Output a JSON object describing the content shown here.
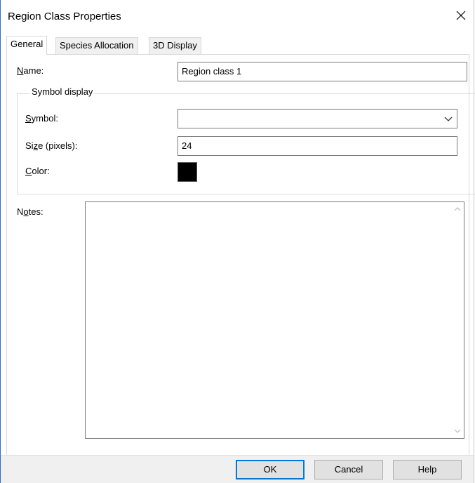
{
  "dialog": {
    "title": "Region Class Properties"
  },
  "tabs": [
    {
      "label": "General",
      "active": true
    },
    {
      "label": "Species Allocation",
      "active": false
    },
    {
      "label": "3D Display",
      "active": false
    }
  ],
  "general": {
    "name": {
      "label_first": "N",
      "label_rest": "ame:",
      "value": "Region class 1"
    },
    "symbol_display": {
      "legend": "Symbol display",
      "symbol": {
        "label_first": "S",
        "label_rest": "ymbol:",
        "value": ""
      },
      "size": {
        "label_pre": "Si",
        "label_ul": "z",
        "label_post": "e (pixels):",
        "value": "24"
      },
      "color": {
        "label_first": "C",
        "label_rest": "olor:",
        "value": "#000000"
      }
    },
    "notes": {
      "label_pre": "N",
      "label_ul": "o",
      "label_post": "tes:",
      "value": ""
    }
  },
  "buttons": {
    "ok": "OK",
    "cancel": "Cancel",
    "help": "Help"
  },
  "icons": {
    "close": "close-icon",
    "dropdown": "chevron-down-icon",
    "scroll_up": "scroll-up-arrow-icon",
    "scroll_down": "scroll-down-arrow-icon"
  }
}
